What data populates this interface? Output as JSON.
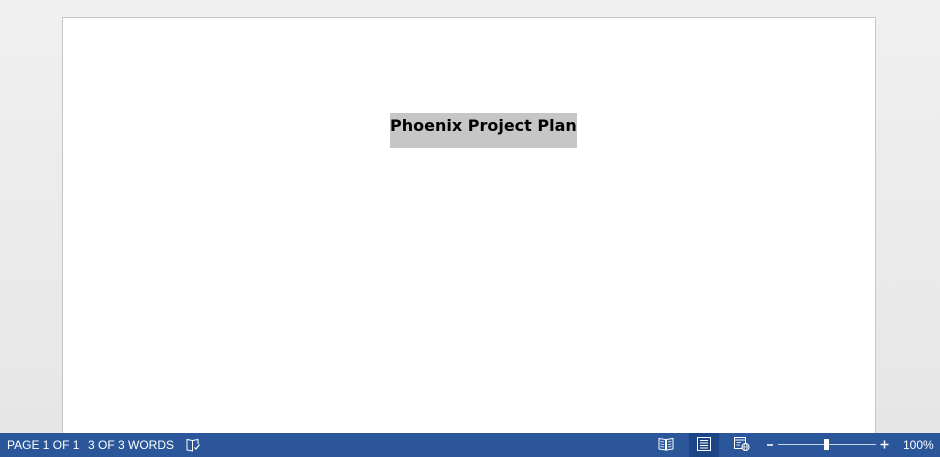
{
  "document": {
    "title_text": "Phoenix Project Plan"
  },
  "statusbar": {
    "page_info": "PAGE 1 OF 1",
    "word_count": "3 OF 3 WORDS",
    "proofing_icon": "proofing-book-icon",
    "views": [
      {
        "name": "read-mode",
        "icon": "book-open-icon",
        "active": false
      },
      {
        "name": "print-layout",
        "icon": "page-lines-icon",
        "active": true
      },
      {
        "name": "web-layout",
        "icon": "web-layout-icon",
        "active": false
      }
    ],
    "zoom": {
      "minus_label": "-",
      "plus_label": "+",
      "level": "100%",
      "slider_fraction": 0.5
    },
    "colors": {
      "background": "#2b579a",
      "active_view": "#1c4587"
    }
  }
}
